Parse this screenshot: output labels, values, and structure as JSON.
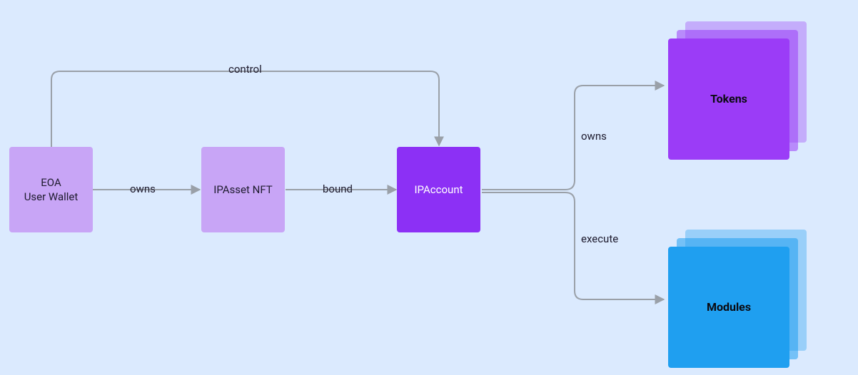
{
  "nodes": {
    "eoa": {
      "label": "EOA\nUser Wallet",
      "fill": "#c8a5f6",
      "text": "#1e1b2e"
    },
    "ipasset": {
      "label": "IPAsset NFT",
      "fill": "#c8a5f6",
      "text": "#1e1b2e"
    },
    "ipaccount": {
      "label": "IPAccount",
      "fill": "#8c30f5",
      "text": "#ffffff"
    },
    "tokens": {
      "label": "Tokens",
      "fill": "#9b3cf7",
      "fillLight": "#c79df9",
      "text": "#0b0b12"
    },
    "modules": {
      "label": "Modules",
      "fill": "#1f9ff0",
      "fillLight": "#6ec2f5",
      "text": "#0b0b12"
    }
  },
  "edges": {
    "eoa_to_ipasset": {
      "label": "owns"
    },
    "ipasset_to_ipaccount": {
      "label": "bound"
    },
    "eoa_to_ipaccount": {
      "label": "control"
    },
    "ipaccount_to_tokens": {
      "label": "owns"
    },
    "ipaccount_to_modules": {
      "label": "execute"
    }
  },
  "arrow": {
    "stroke": "#9aa0a8"
  }
}
